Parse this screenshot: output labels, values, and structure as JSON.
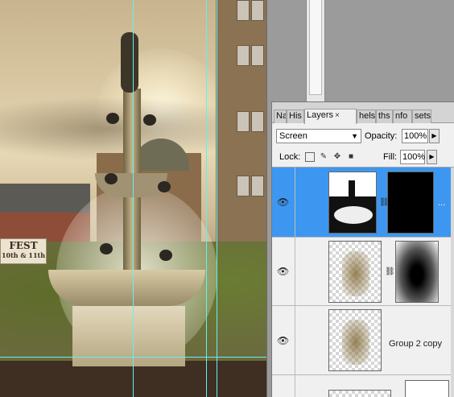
{
  "canvas": {
    "banner_line1": "FEST",
    "banner_line2": "10th & 11th"
  },
  "layers_panel": {
    "tabs": [
      {
        "label": "Na"
      },
      {
        "label": "His"
      },
      {
        "label": "Layers",
        "active": true
      },
      {
        "label": "hels"
      },
      {
        "label": "ths"
      },
      {
        "label": "nfo"
      },
      {
        "label": "sets"
      }
    ],
    "tab_close": "×",
    "blend_mode": "Screen",
    "opacity_label": "Opacity:",
    "opacity_value": "100%",
    "lock_label": "Lock:",
    "fill_label": "Fill:",
    "fill_value": "100%",
    "layers": [
      {
        "name": "",
        "selected": true,
        "ellipsis": "..."
      },
      {
        "name": "",
        "selected": false
      },
      {
        "name": "Group 2 copy",
        "selected": false
      }
    ],
    "colors": {
      "selection": "#3d97f0",
      "guide": "#5ff2ee"
    }
  }
}
